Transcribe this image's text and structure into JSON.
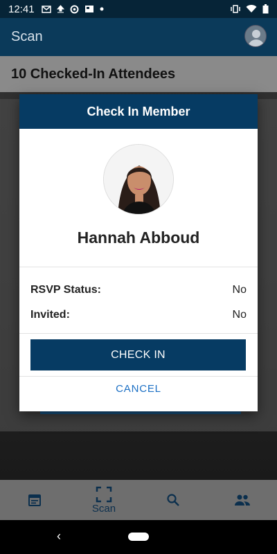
{
  "status_bar": {
    "time": "12:41",
    "left_icons": [
      "gmail-icon",
      "upload-icon",
      "sync-icon",
      "news-icon",
      "dot-icon"
    ],
    "right_icons": [
      "vibrate-icon",
      "wifi-icon",
      "battery-icon"
    ]
  },
  "app_bar": {
    "title": "Scan"
  },
  "attendees": {
    "count_label": "10 Checked-In Attendees"
  },
  "modal": {
    "title": "Check In Member",
    "member_name": "Hannah Abboud",
    "fields": [
      {
        "label": "RSVP Status:",
        "value": "No"
      },
      {
        "label": "Invited:",
        "value": "No"
      }
    ],
    "check_in_label": "CHECK IN",
    "cancel_label": "CANCEL"
  },
  "bottom_nav": {
    "items": [
      {
        "icon": "calendar-icon",
        "label": ""
      },
      {
        "icon": "scan-icon",
        "label": "Scan"
      },
      {
        "icon": "search-icon",
        "label": ""
      },
      {
        "icon": "people-icon",
        "label": ""
      }
    ]
  },
  "colors": {
    "primary": "#063b63",
    "link": "#1b6fc4",
    "status_bar": "#062437"
  }
}
